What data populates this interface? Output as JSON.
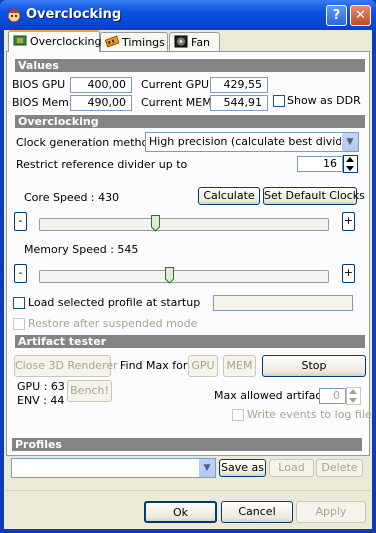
{
  "window": {
    "title": "Overclocking",
    "help_label": "?",
    "close_label": "✕",
    "icon": "app-icon"
  },
  "tabs": [
    {
      "label": "Overclocking",
      "icon": "chip-icon",
      "active": true
    },
    {
      "label": "Timings",
      "icon": "memory-icon",
      "active": false
    },
    {
      "label": "Fan",
      "icon": "fan-icon",
      "active": false
    }
  ],
  "values": {
    "header": "Values",
    "bios_gpu_label": "BIOS GPU",
    "bios_gpu": "400,00",
    "current_gpu_label": "Current GPU",
    "current_gpu": "429,55",
    "bios_mem_label": "BIOS Mem",
    "bios_mem": "490,00",
    "current_mem_label": "Current MEM",
    "current_mem": "544,91",
    "show_ddr_label": "Show as DDR",
    "show_ddr_checked": false
  },
  "overclocking": {
    "header": "Overclocking",
    "clock_method_label": "Clock generation method",
    "clock_method_value": "High precision (calculate best divider)",
    "restrict_label": "Restrict reference divider up to",
    "restrict_value": "16",
    "core_speed_label": "Core Speed : 430",
    "core_slider_fraction": 0.4,
    "calculate_label": "Calculate",
    "set_default_label": "Set Default Clocks",
    "memory_speed_label": "Memory Speed : 545",
    "memory_slider_fraction": 0.45,
    "minus_label": "-",
    "plus_label": "+",
    "load_profile_label": "Load selected profile at startup",
    "restore_label": "Restore after suspended mode"
  },
  "artifact": {
    "header": "Artifact tester",
    "close_3d_label": "Close 3D Renderer",
    "find_max_label": "Find Max for",
    "gpu_label": "GPU",
    "mem_label": "MEM",
    "stop_label": "Stop",
    "gpu_count": "GPU : 63",
    "env_count": "ENV : 44",
    "bench_label": "Bench!",
    "max_allowed_label": "Max allowed artifacts",
    "max_allowed_value": "0",
    "write_events_label": "Write events to log file"
  },
  "profiles": {
    "header": "Profiles",
    "selected": "",
    "save_as_label": "Save as",
    "load_label": "Load",
    "delete_label": "Delete"
  },
  "footer": {
    "ok_label": "Ok",
    "cancel_label": "Cancel",
    "apply_label": "Apply"
  }
}
